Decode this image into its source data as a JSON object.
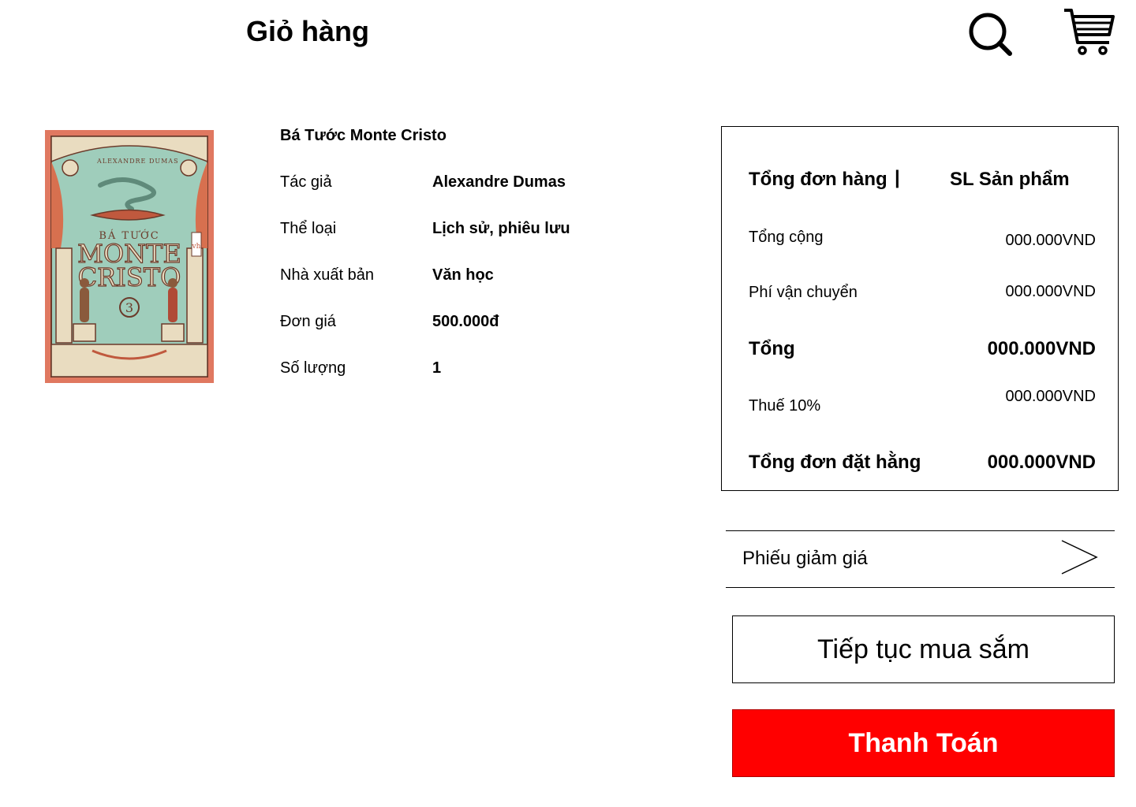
{
  "header": {
    "title": "Giỏ hàng",
    "search_icon": "search-icon",
    "cart_icon": "cart-icon"
  },
  "book": {
    "title": "Bá Tước Monte Cristo",
    "cover": {
      "top_text": "ALEXANDRE DUMAS",
      "line1": "BÁ TƯỚC",
      "line2": "MONTE",
      "line3": "CRISTO",
      "volume": "3",
      "publisher_mark": "vh",
      "colors": {
        "frame": "#e07860",
        "background": "#9fcdbb",
        "ornament": "#e9dcc0",
        "ink": "#6b3a2a"
      }
    },
    "fields": [
      {
        "label": "Tác giả",
        "value": "Alexandre Dumas"
      },
      {
        "label": "Thể loại",
        "value": "Lịch sử, phiêu lưu"
      },
      {
        "label": "Nhà xuất bản",
        "value": "Văn học"
      },
      {
        "label": "Đơn giá",
        "value": "500.000đ"
      },
      {
        "label": "Số lượng",
        "value": "1"
      }
    ]
  },
  "summary": {
    "header_left": "Tổng đơn hàng",
    "separator": "|",
    "header_right": "SL Sản phẩm",
    "rows": [
      {
        "label": "Tổng cộng",
        "value": "000.000VND"
      },
      {
        "label": "Phí vận chuyển",
        "value": "000.000VND"
      },
      {
        "label": "Tổng",
        "value": "000.000VND"
      },
      {
        "label": "Thuế 10%",
        "value": "000.000VND"
      },
      {
        "label": "Tổng đơn đặt hằng",
        "value": "000.000VND"
      }
    ]
  },
  "coupon": {
    "label": "Phiếu giảm giá",
    "icon": "chevron-right-icon"
  },
  "actions": {
    "continue_label": "Tiếp tục mua sắm",
    "pay_label": "Thanh Toán",
    "pay_color": "#ff0000"
  }
}
